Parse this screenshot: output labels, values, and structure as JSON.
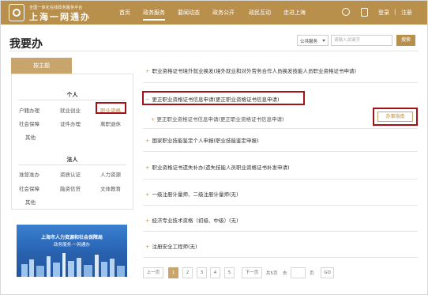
{
  "header": {
    "logo_subtitle": "全国一体化在线政务服务平台",
    "logo_title": "上海一网通办",
    "nav": [
      "首页",
      "政务服务",
      "要闻动态",
      "政务公开",
      "政民互动",
      "走进上海"
    ],
    "active_nav": "政务服务",
    "icons": [
      "elder-mode-icon",
      "mobile-icon"
    ],
    "login": "登录",
    "register": "注册",
    "separator": "|"
  },
  "page": {
    "title": "我要办"
  },
  "search": {
    "select_value": "公共服务",
    "placeholder": "请输入关键字",
    "button": "搜索"
  },
  "sidebar": {
    "tab": "按主题",
    "personal_heading": "个人",
    "personal_items": [
      "户籍办理",
      "就业创业",
      "职业资格",
      "社会保障",
      "证件办理",
      "离职退休",
      "其他"
    ],
    "legal_heading": "法人",
    "legal_items": [
      "准营准办",
      "资质认证",
      "人力资源",
      "社会保障",
      "融资信贷",
      "文体教育",
      "其他"
    ],
    "banner": {
      "line1": "上海市人力资源和社会保障局",
      "line2": "政务服务·一网通办"
    }
  },
  "services": [
    "职业资格证书境外就业换发(境外就业和对外劳务合作人员换发技能人员职业资格证书申请)",
    "更正职业资格证书信息申请(更正职业资格证书信息申请)",
    "国家职业技能鉴定个人申报(职业技能鉴定申报)",
    "职业资格证书遗失补办(遗失技能人员职业资格证书补发申请)",
    "一级注册计量师、二级注册计量师(无)",
    "经济专业技术资格（初级、中级）(无)",
    "注册安全工程师(无)"
  ],
  "sub_service": {
    "label": "更正职业资格证书信息申请(更正职业资格证书信息申请)",
    "button": "办事指南"
  },
  "pagination": {
    "prev": "上一页",
    "pages": [
      "1",
      "2",
      "3",
      "4",
      "5"
    ],
    "current": "1",
    "next": "下一页",
    "total": "共5页",
    "goto": "去",
    "page_unit": "页",
    "go": "GO"
  },
  "colors": {
    "brand": "#b98f4c",
    "highlight_box": "#a50f16",
    "tab": "#c9a56e"
  }
}
